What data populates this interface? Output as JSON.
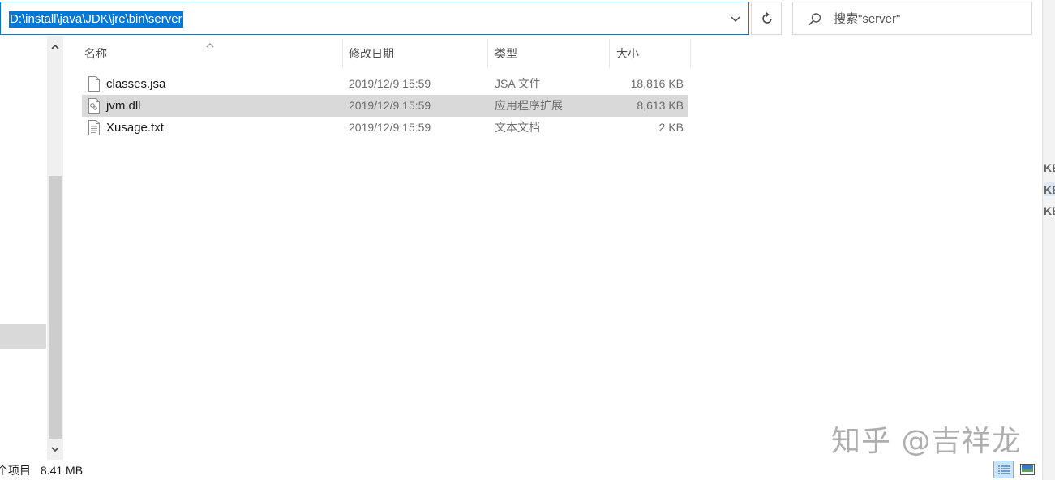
{
  "address_bar": {
    "path": "D:\\install\\java\\JDK\\jre\\bin\\server"
  },
  "search": {
    "placeholder": "搜索\"server\""
  },
  "columns": {
    "name": "名称",
    "date": "修改日期",
    "type": "类型",
    "size": "大小"
  },
  "files": [
    {
      "name": "classes.jsa",
      "date": "2019/12/9 15:59",
      "type": "JSA 文件",
      "size": "18,816 KB",
      "icon": "generic-file-icon",
      "selected": false
    },
    {
      "name": "jvm.dll",
      "date": "2019/12/9 15:59",
      "type": "应用程序扩展",
      "size": "8,613 KB",
      "icon": "dll-file-icon",
      "selected": true
    },
    {
      "name": "Xusage.txt",
      "date": "2019/12/9 15:59",
      "type": "文本文档",
      "size": "2 KB",
      "icon": "text-file-icon",
      "selected": false
    }
  ],
  "status_bar": {
    "item_count": "个项目",
    "selected_size": "8.41 MB"
  },
  "edge_labels": [
    "KE",
    "KE",
    "KE"
  ],
  "watermark": "知乎 @吉祥龙",
  "colors": {
    "accent": "#0078d7",
    "selection": "#d9d9d9"
  }
}
